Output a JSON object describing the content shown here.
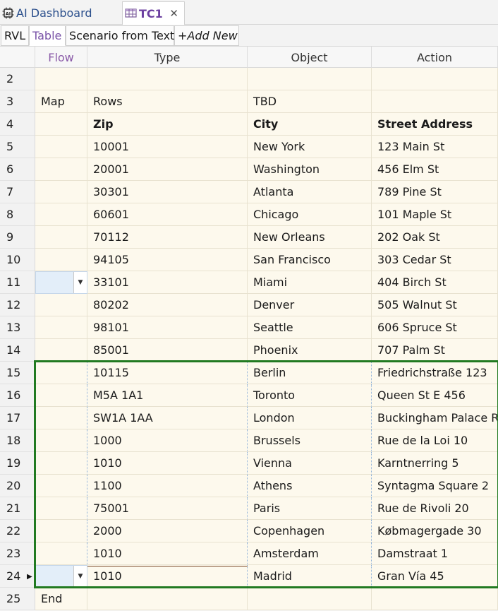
{
  "tabs": {
    "inactive_label": "AI Dashboard",
    "active_label": "TC1",
    "close_glyph": "✕"
  },
  "subtabs": [
    "RVL",
    "Table",
    "Scenario from Text",
    "+Add New"
  ],
  "columns": [
    "Flow",
    "Type",
    "Object",
    "Action"
  ],
  "rows": [
    {
      "num": "2",
      "flow": "",
      "type": "",
      "object": "",
      "action": ""
    },
    {
      "num": "3",
      "flow": "Map",
      "type": "Rows",
      "object": "TBD",
      "action": ""
    },
    {
      "num": "4",
      "flow": "",
      "type": "Zip",
      "object": "City",
      "action": "Street Address"
    },
    {
      "num": "5",
      "flow": "",
      "type": "10001",
      "object": "New York",
      "action": "123 Main St"
    },
    {
      "num": "6",
      "flow": "",
      "type": "20001",
      "object": "Washington",
      "action": "456 Elm St"
    },
    {
      "num": "7",
      "flow": "",
      "type": "30301",
      "object": "Atlanta",
      "action": "789 Pine St"
    },
    {
      "num": "8",
      "flow": "",
      "type": "60601",
      "object": "Chicago",
      "action": "101 Maple St"
    },
    {
      "num": "9",
      "flow": "",
      "type": "70112",
      "object": "New Orleans",
      "action": "202 Oak St"
    },
    {
      "num": "10",
      "flow": "",
      "type": "94105",
      "object": "San Francisco",
      "action": "303 Cedar St"
    },
    {
      "num": "11",
      "flow": "",
      "type": "33101",
      "object": "Miami",
      "action": "404 Birch St"
    },
    {
      "num": "12",
      "flow": "",
      "type": "80202",
      "object": "Denver",
      "action": "505 Walnut St"
    },
    {
      "num": "13",
      "flow": "",
      "type": "98101",
      "object": "Seattle",
      "action": "606 Spruce St"
    },
    {
      "num": "14",
      "flow": "",
      "type": "85001",
      "object": "Phoenix",
      "action": "707 Palm St"
    },
    {
      "num": "15",
      "flow": "",
      "type": "10115",
      "object": "Berlin",
      "action": "Friedrichstraße 123"
    },
    {
      "num": "16",
      "flow": "",
      "type": "M5A 1A1",
      "object": "Toronto",
      "action": "Queen St E 456"
    },
    {
      "num": "17",
      "flow": "",
      "type": "SW1A 1AA",
      "object": "London",
      "action": "Buckingham Palace R"
    },
    {
      "num": "18",
      "flow": "",
      "type": "1000",
      "object": "Brussels",
      "action": "Rue de la Loi 10"
    },
    {
      "num": "19",
      "flow": "",
      "type": "1010",
      "object": "Vienna",
      "action": "Karntnerring 5"
    },
    {
      "num": "20",
      "flow": "",
      "type": "1100",
      "object": "Athens",
      "action": "Syntagma Square 2"
    },
    {
      "num": "21",
      "flow": "",
      "type": "75001",
      "object": "Paris",
      "action": "Rue de Rivoli 20"
    },
    {
      "num": "22",
      "flow": "",
      "type": "2000",
      "object": "Copenhagen",
      "action": "Købmagergade 30"
    },
    {
      "num": "23",
      "flow": "",
      "type": "1010",
      "object": "Amsterdam",
      "action": "Damstraat 1"
    },
    {
      "num": "24",
      "flow": "",
      "type": "1010",
      "object": "Madrid",
      "action": "Gran Vía 45"
    },
    {
      "num": "25",
      "flow": "End",
      "type": "",
      "object": "",
      "action": ""
    }
  ],
  "icons": {
    "ai_dashboard": "ai-chip-icon",
    "table_tab": "table-grid-icon",
    "dropdown": "chevron-down-icon",
    "row_pointer": "current-row-pointer-icon"
  },
  "colors": {
    "active_tab_text": "#6b3fa0",
    "cell_background": "#fdf9ed",
    "selection_border": "#217a21",
    "dropdown_cell": "#e3eef9"
  }
}
